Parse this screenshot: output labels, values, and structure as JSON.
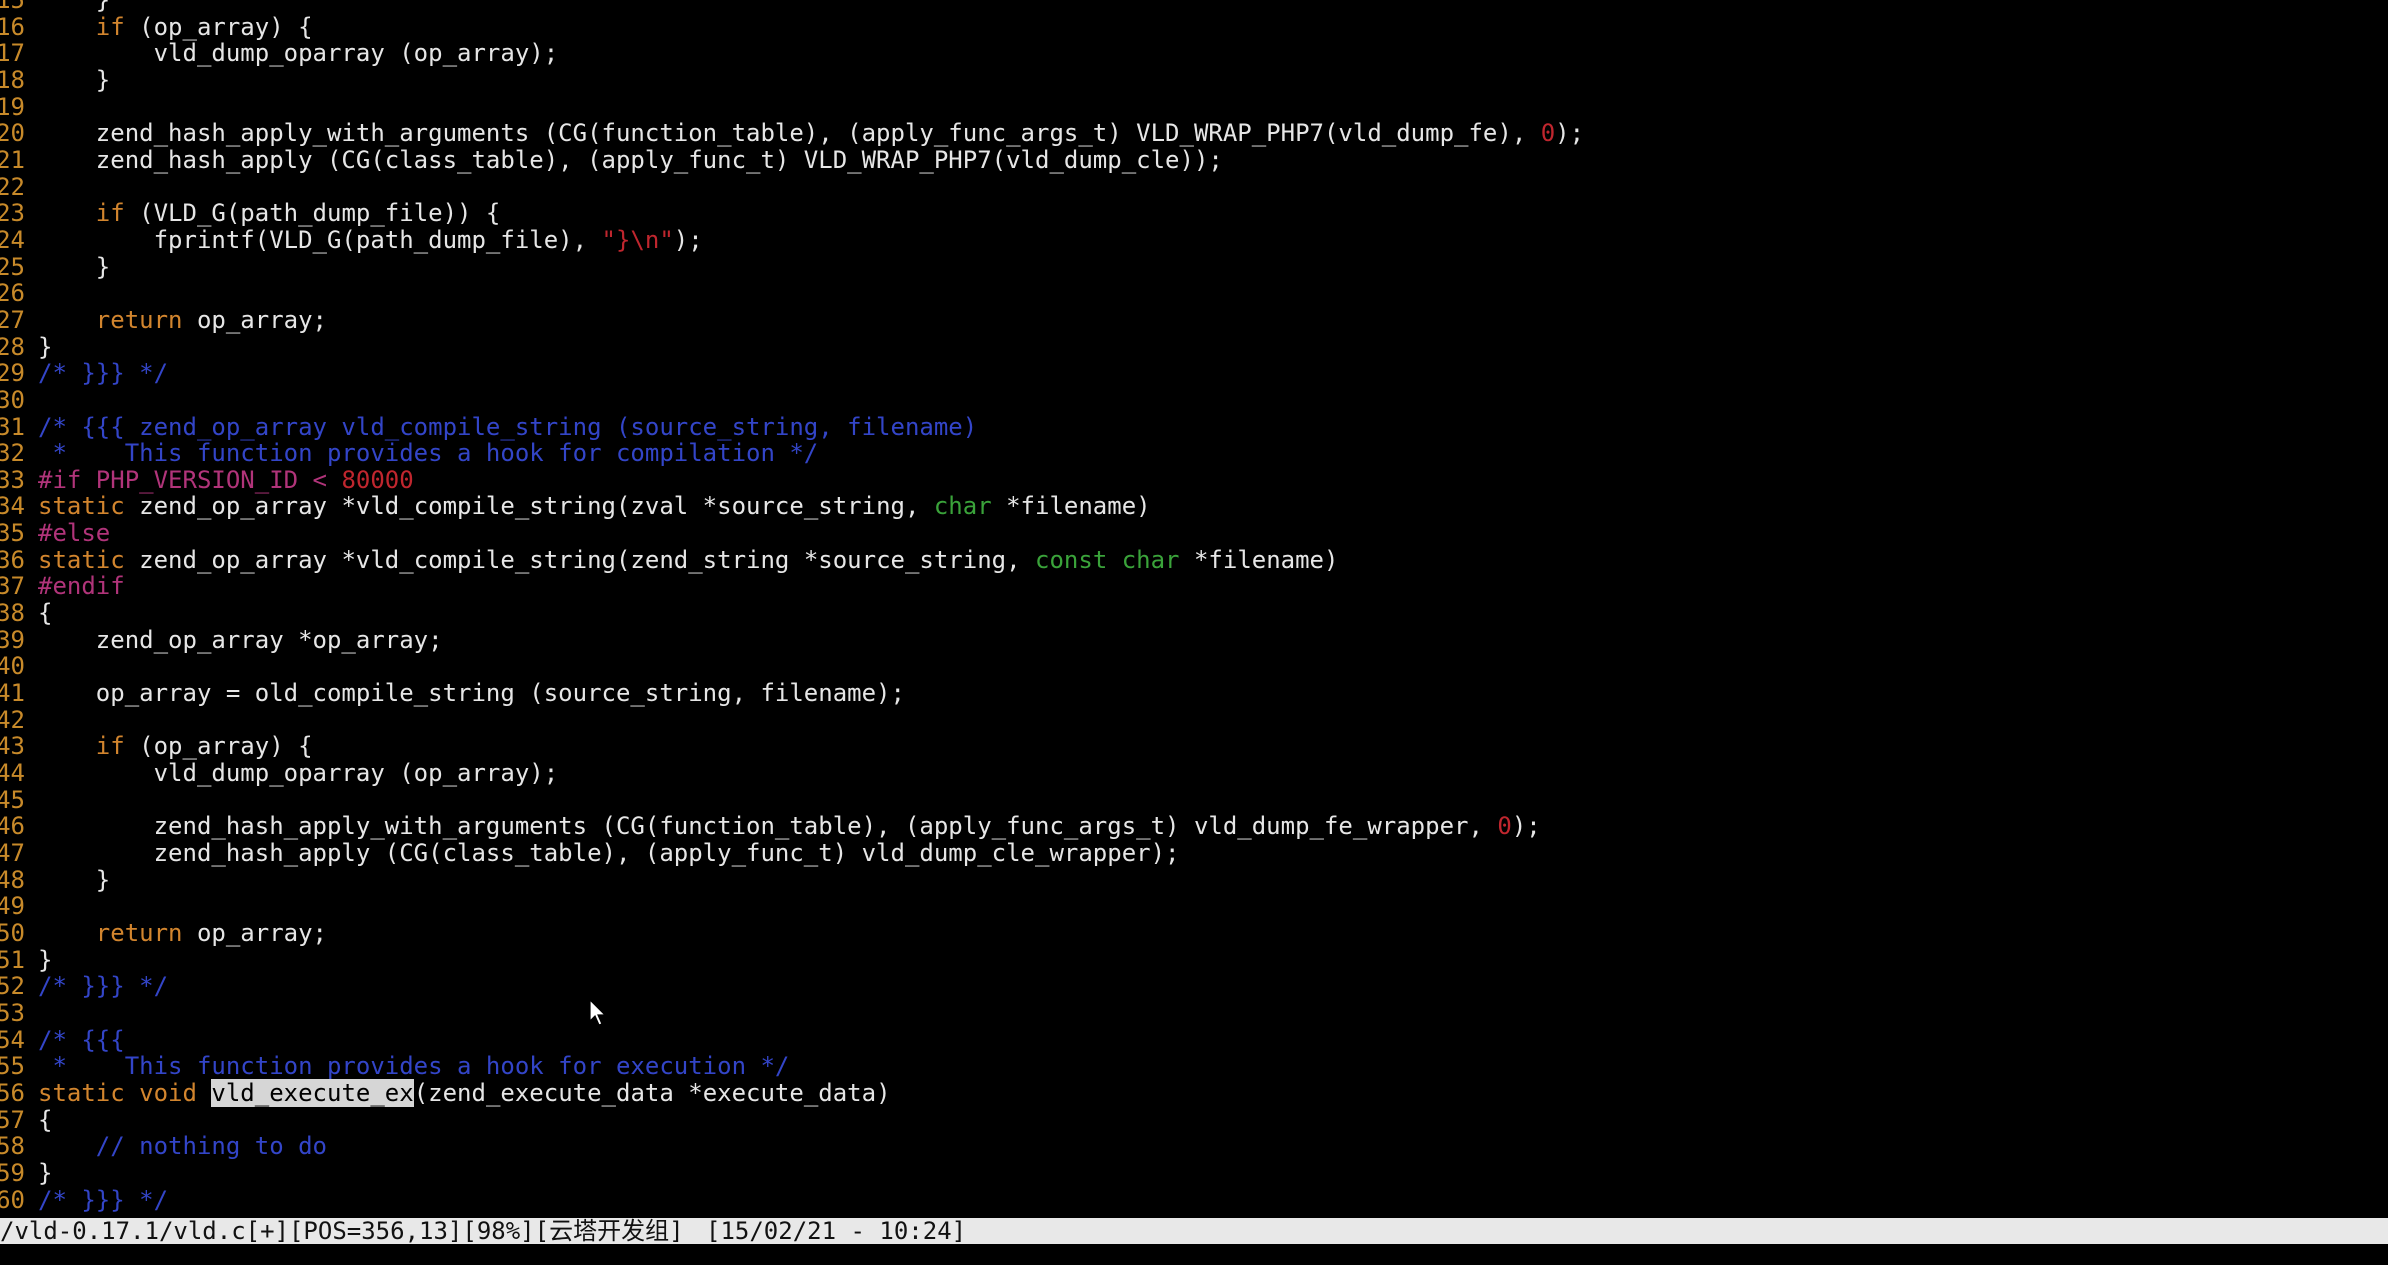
{
  "editor": {
    "lines": [
      {
        "n": "15",
        "tokens": [
          {
            "t": "    }",
            "c": "plain"
          }
        ]
      },
      {
        "n": "16",
        "tokens": [
          {
            "t": "    ",
            "c": "plain"
          },
          {
            "t": "if",
            "c": "kw"
          },
          {
            "t": " (op_array) {",
            "c": "plain"
          }
        ]
      },
      {
        "n": "17",
        "tokens": [
          {
            "t": "        vld_dump_oparray (op_array);",
            "c": "plain"
          }
        ]
      },
      {
        "n": "18",
        "tokens": [
          {
            "t": "    }",
            "c": "plain"
          }
        ]
      },
      {
        "n": "19",
        "tokens": []
      },
      {
        "n": "20",
        "tokens": [
          {
            "t": "    zend_hash_apply_with_arguments (CG(function_table), (apply_func_args_t) VLD_WRAP_PHP7(vld_dump_fe), ",
            "c": "plain"
          },
          {
            "t": "0",
            "c": "num"
          },
          {
            "t": ");",
            "c": "plain"
          }
        ]
      },
      {
        "n": "21",
        "tokens": [
          {
            "t": "    zend_hash_apply (CG(class_table), (apply_func_t) VLD_WRAP_PHP7(vld_dump_cle));",
            "c": "plain"
          }
        ]
      },
      {
        "n": "22",
        "tokens": []
      },
      {
        "n": "23",
        "tokens": [
          {
            "t": "    ",
            "c": "plain"
          },
          {
            "t": "if",
            "c": "kw"
          },
          {
            "t": " (VLD_G(path_dump_file)) {",
            "c": "plain"
          }
        ]
      },
      {
        "n": "24",
        "tokens": [
          {
            "t": "        fprintf(VLD_G(path_dump_file), ",
            "c": "plain"
          },
          {
            "t": "\"}\\n\"",
            "c": "str"
          },
          {
            "t": ");",
            "c": "plain"
          }
        ]
      },
      {
        "n": "25",
        "tokens": [
          {
            "t": "    }",
            "c": "plain"
          }
        ]
      },
      {
        "n": "26",
        "tokens": []
      },
      {
        "n": "27",
        "tokens": [
          {
            "t": "    ",
            "c": "plain"
          },
          {
            "t": "return",
            "c": "kw"
          },
          {
            "t": " op_array;",
            "c": "plain"
          }
        ]
      },
      {
        "n": "28",
        "tokens": [
          {
            "t": "}",
            "c": "plain"
          }
        ]
      },
      {
        "n": "29",
        "tokens": [
          {
            "t": "/* }}} */",
            "c": "comment"
          }
        ]
      },
      {
        "n": "30",
        "tokens": []
      },
      {
        "n": "31",
        "tokens": [
          {
            "t": "/* {{{ zend_op_array vld_compile_string (source_string, filename)",
            "c": "comment"
          }
        ]
      },
      {
        "n": "32",
        "tokens": [
          {
            "t": " *    This function provides a hook for compilation */",
            "c": "comment"
          }
        ]
      },
      {
        "n": "33",
        "tokens": [
          {
            "t": "#if PHP_VERSION_ID < ",
            "c": "pre"
          },
          {
            "t": "80000",
            "c": "num"
          }
        ]
      },
      {
        "n": "34",
        "tokens": [
          {
            "t": "static",
            "c": "kw"
          },
          {
            "t": " zend_op_array *vld_compile_string(zval *source_string, ",
            "c": "plain"
          },
          {
            "t": "char",
            "c": "type"
          },
          {
            "t": " *filename)",
            "c": "plain"
          }
        ]
      },
      {
        "n": "35",
        "tokens": [
          {
            "t": "#else",
            "c": "pre"
          }
        ]
      },
      {
        "n": "36",
        "tokens": [
          {
            "t": "static",
            "c": "kw"
          },
          {
            "t": " zend_op_array *vld_compile_string(zend_string *source_string, ",
            "c": "plain"
          },
          {
            "t": "const char",
            "c": "type"
          },
          {
            "t": " *filename)",
            "c": "plain"
          }
        ]
      },
      {
        "n": "37",
        "tokens": [
          {
            "t": "#endif",
            "c": "pre"
          }
        ]
      },
      {
        "n": "38",
        "tokens": [
          {
            "t": "{",
            "c": "plain"
          }
        ]
      },
      {
        "n": "39",
        "tokens": [
          {
            "t": "    zend_op_array *op_array;",
            "c": "plain"
          }
        ]
      },
      {
        "n": "40",
        "tokens": []
      },
      {
        "n": "41",
        "tokens": [
          {
            "t": "    op_array = old_compile_string (source_string, filename);",
            "c": "plain"
          }
        ]
      },
      {
        "n": "42",
        "tokens": []
      },
      {
        "n": "43",
        "tokens": [
          {
            "t": "    ",
            "c": "plain"
          },
          {
            "t": "if",
            "c": "kw"
          },
          {
            "t": " (op_array) {",
            "c": "plain"
          }
        ]
      },
      {
        "n": "44",
        "tokens": [
          {
            "t": "        vld_dump_oparray (op_array);",
            "c": "plain"
          }
        ]
      },
      {
        "n": "45",
        "tokens": []
      },
      {
        "n": "46",
        "tokens": [
          {
            "t": "        zend_hash_apply_with_arguments (CG(function_table), (apply_func_args_t) vld_dump_fe_wrapper, ",
            "c": "plain"
          },
          {
            "t": "0",
            "c": "num"
          },
          {
            "t": ");",
            "c": "plain"
          }
        ]
      },
      {
        "n": "47",
        "tokens": [
          {
            "t": "        zend_hash_apply (CG(class_table), (apply_func_t) vld_dump_cle_wrapper);",
            "c": "plain"
          }
        ]
      },
      {
        "n": "48",
        "tokens": [
          {
            "t": "    }",
            "c": "plain"
          }
        ]
      },
      {
        "n": "49",
        "tokens": []
      },
      {
        "n": "50",
        "tokens": [
          {
            "t": "    ",
            "c": "plain"
          },
          {
            "t": "return",
            "c": "kw"
          },
          {
            "t": " op_array;",
            "c": "plain"
          }
        ]
      },
      {
        "n": "51",
        "tokens": [
          {
            "t": "}",
            "c": "plain"
          }
        ]
      },
      {
        "n": "52",
        "tokens": [
          {
            "t": "/* }}} */",
            "c": "comment"
          }
        ]
      },
      {
        "n": "53",
        "tokens": []
      },
      {
        "n": "54",
        "tokens": [
          {
            "t": "/* {{{",
            "c": "comment"
          }
        ]
      },
      {
        "n": "55",
        "tokens": [
          {
            "t": " *    This function provides a hook for execution */",
            "c": "comment"
          }
        ]
      },
      {
        "n": "56",
        "tokens": [
          {
            "t": "static void",
            "c": "kw"
          },
          {
            "t": " ",
            "c": "plain"
          },
          {
            "t": "vld_execute_ex",
            "c": "hl"
          },
          {
            "t": "(zend_execute_data *execute_data)",
            "c": "plain"
          }
        ]
      },
      {
        "n": "57",
        "tokens": [
          {
            "t": "{",
            "c": "plain"
          }
        ]
      },
      {
        "n": "58",
        "tokens": [
          {
            "t": "    // nothing to do",
            "c": "comment"
          }
        ]
      },
      {
        "n": "59",
        "tokens": [
          {
            "t": "}",
            "c": "plain"
          }
        ]
      },
      {
        "n": "60",
        "tokens": [
          {
            "t": "/* }}} */",
            "c": "comment"
          }
        ]
      }
    ]
  },
  "status_bar": {
    "file_info": "/vld-0.17.1/vld.c[+][POS=356,13][98%][云塔开发组]",
    "datetime": "[15/02/21 - 10:24]"
  },
  "command_line": {
    "text": "vld_execute_ex"
  },
  "colors": {
    "background": "#000000",
    "line_number": "#c88a2a",
    "keyword": "#d2852e",
    "comment": "#3345c8",
    "preprocessor": "#b1347a",
    "type": "#3aa33a",
    "string_number": "#c0262e",
    "search_highlight": "#d6d6d6"
  }
}
